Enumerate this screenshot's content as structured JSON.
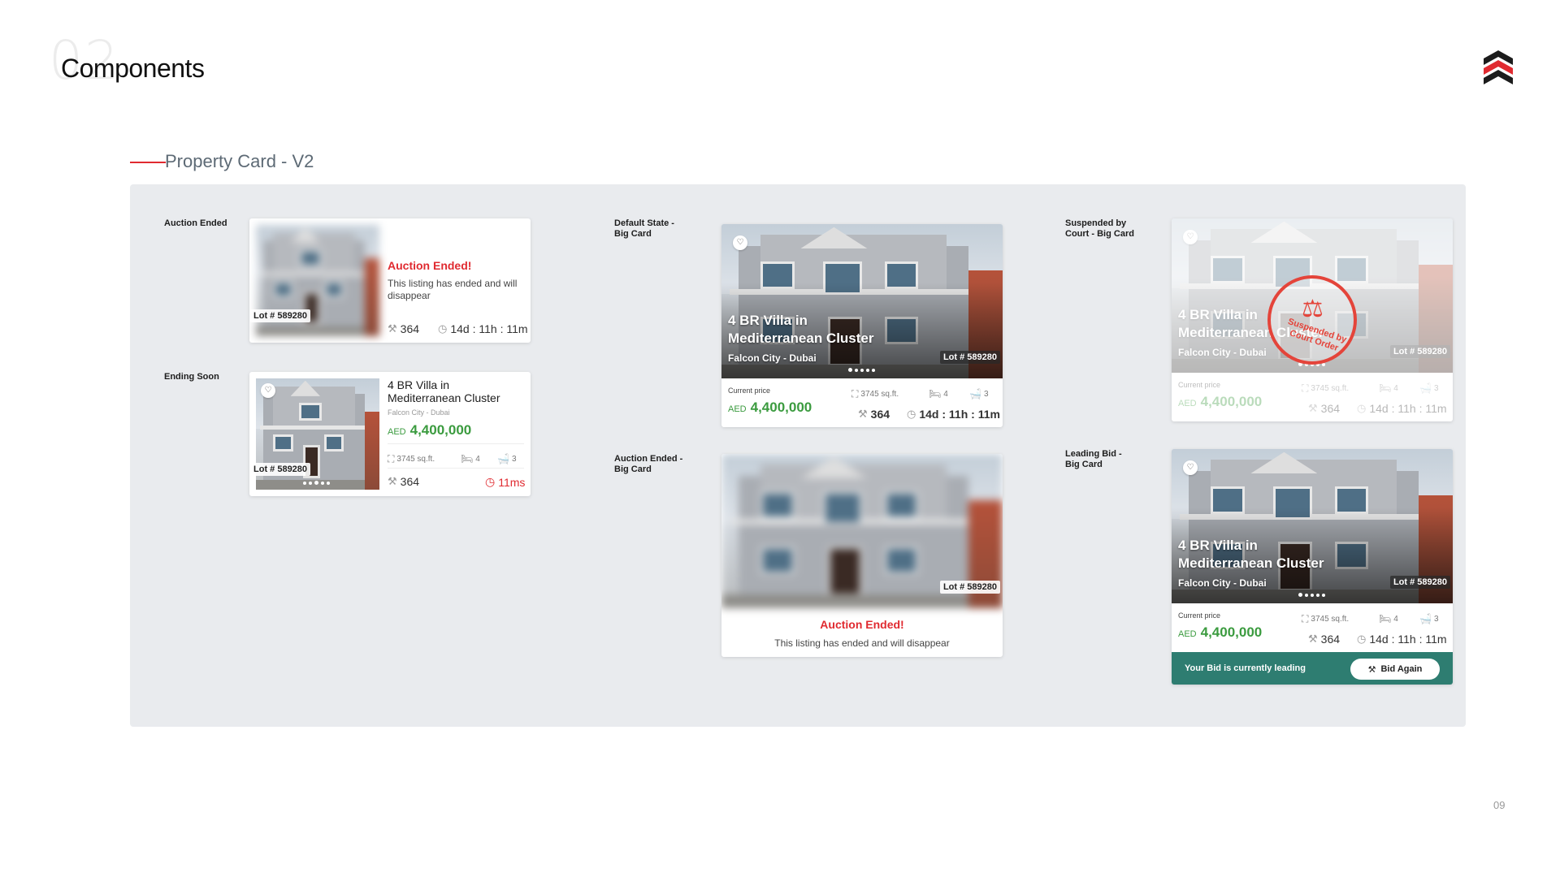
{
  "header": {
    "bg_number": "02",
    "title": "Components",
    "logo": "brand-chevron-logo"
  },
  "section": {
    "title": "Property Card - V2"
  },
  "labels": {
    "auction_ended": "Auction Ended",
    "ending_soon": "Ending Soon",
    "default_big_1": "Default State -",
    "default_big_2": "Big Card",
    "ended_big_1": "Auction Ended -",
    "ended_big_2": "Big Card",
    "suspended_big_1": "Suspended by",
    "suspended_big_2": "Court - Big Card",
    "leading_big_1": "Leading Bid -",
    "leading_big_2": "Big Card"
  },
  "common": {
    "lot": "Lot # 589280",
    "title_line1": "4 BR Villa in",
    "title_line2": "Mediterranean Cluster",
    "title_full": "4 BR Villa in Mediterranean Cluster",
    "location": "Falcon City - Dubai",
    "current_price_label": "Current price",
    "currency": "AED",
    "price": "4,400,000",
    "area": "3745 sq.ft.",
    "beds": "4",
    "baths": "3",
    "bids": "364",
    "time_left": "14d : 11h : 11m",
    "icons": [
      "gavel-icon",
      "timer-icon",
      "area-icon",
      "bed-icon",
      "bath-icon",
      "heart-icon",
      "scale-icon"
    ]
  },
  "auction_ended_card": {
    "title": "Auction Ended!",
    "message": "This listing has ended and will disappear"
  },
  "ending_soon_card": {
    "time_left": "11ms",
    "urgent_color": "#e02a30"
  },
  "ended_big_card": {
    "title": "Auction Ended!",
    "message": "This listing has ended and will disappear"
  },
  "suspended_card": {
    "stamp_text_1": "Suspended by",
    "stamp_text_2": "Court Order"
  },
  "leading_card": {
    "status": "Your Bid is currently leading",
    "button": "Bid Again",
    "bar_color": "#2e7d71"
  },
  "footer": {
    "page_number": "09"
  },
  "colors": {
    "accent_red": "#e02a30",
    "price_green": "#3b9b3f",
    "panel_bg": "#e9ebee"
  }
}
